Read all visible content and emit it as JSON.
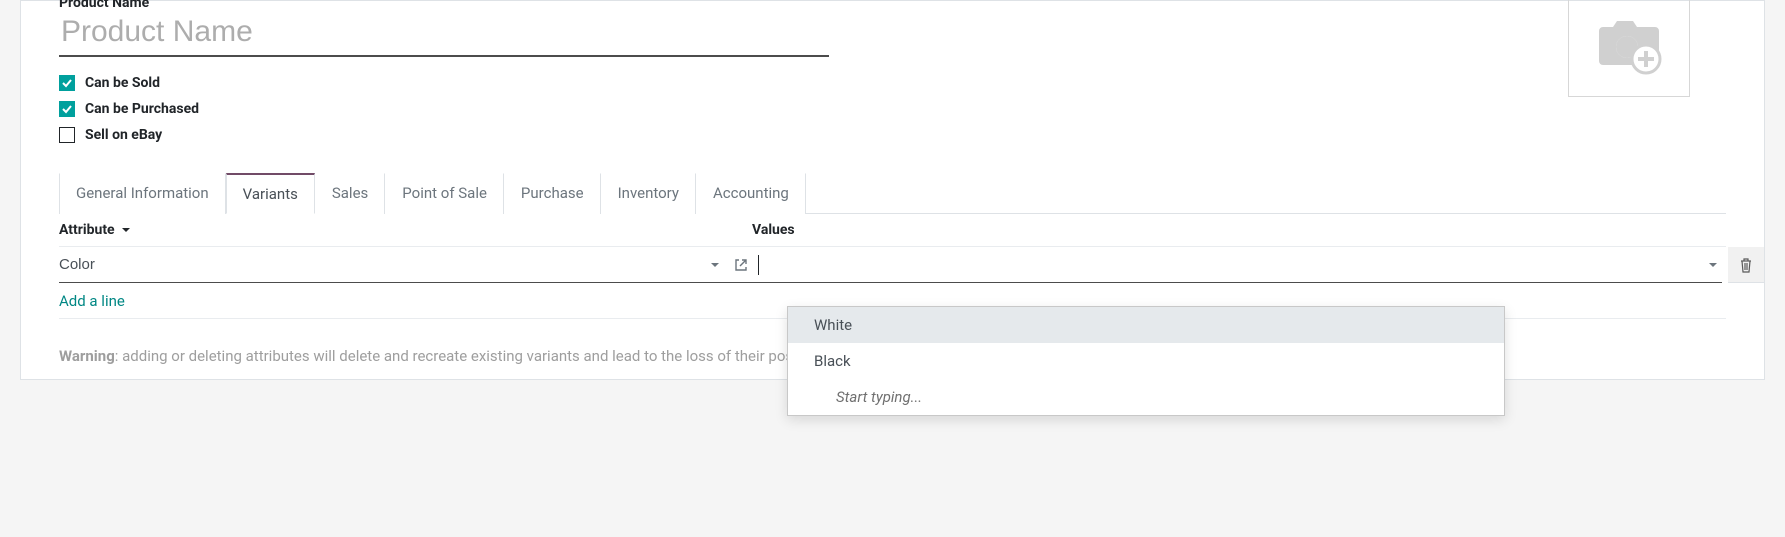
{
  "header": {
    "product_name_label": "Product Name",
    "product_name_value": "",
    "product_name_placeholder": "Product Name"
  },
  "checkboxes": {
    "can_be_sold": {
      "label": "Can be Sold",
      "checked": true
    },
    "can_be_purchased": {
      "label": "Can be Purchased",
      "checked": true
    },
    "sell_on_ebay": {
      "label": "Sell on eBay",
      "checked": false
    }
  },
  "tabs": [
    {
      "label": "General Information",
      "active": false
    },
    {
      "label": "Variants",
      "active": true
    },
    {
      "label": "Sales",
      "active": false
    },
    {
      "label": "Point of Sale",
      "active": false
    },
    {
      "label": "Purchase",
      "active": false
    },
    {
      "label": "Inventory",
      "active": false
    },
    {
      "label": "Accounting",
      "active": false
    }
  ],
  "grid": {
    "headers": {
      "attribute": "Attribute",
      "values": "Values"
    },
    "rows": [
      {
        "attribute": "Color",
        "values": ""
      }
    ],
    "add_line": "Add a line"
  },
  "values_dropdown": {
    "options": [
      {
        "label": "White",
        "highlight": true
      },
      {
        "label": "Black",
        "highlight": false
      }
    ],
    "hint": "Start typing..."
  },
  "warning": {
    "prefix": "Warning",
    "text": ": adding or deleting attributes will delete and recreate existing variants and lead to the loss of their possible customizations."
  }
}
